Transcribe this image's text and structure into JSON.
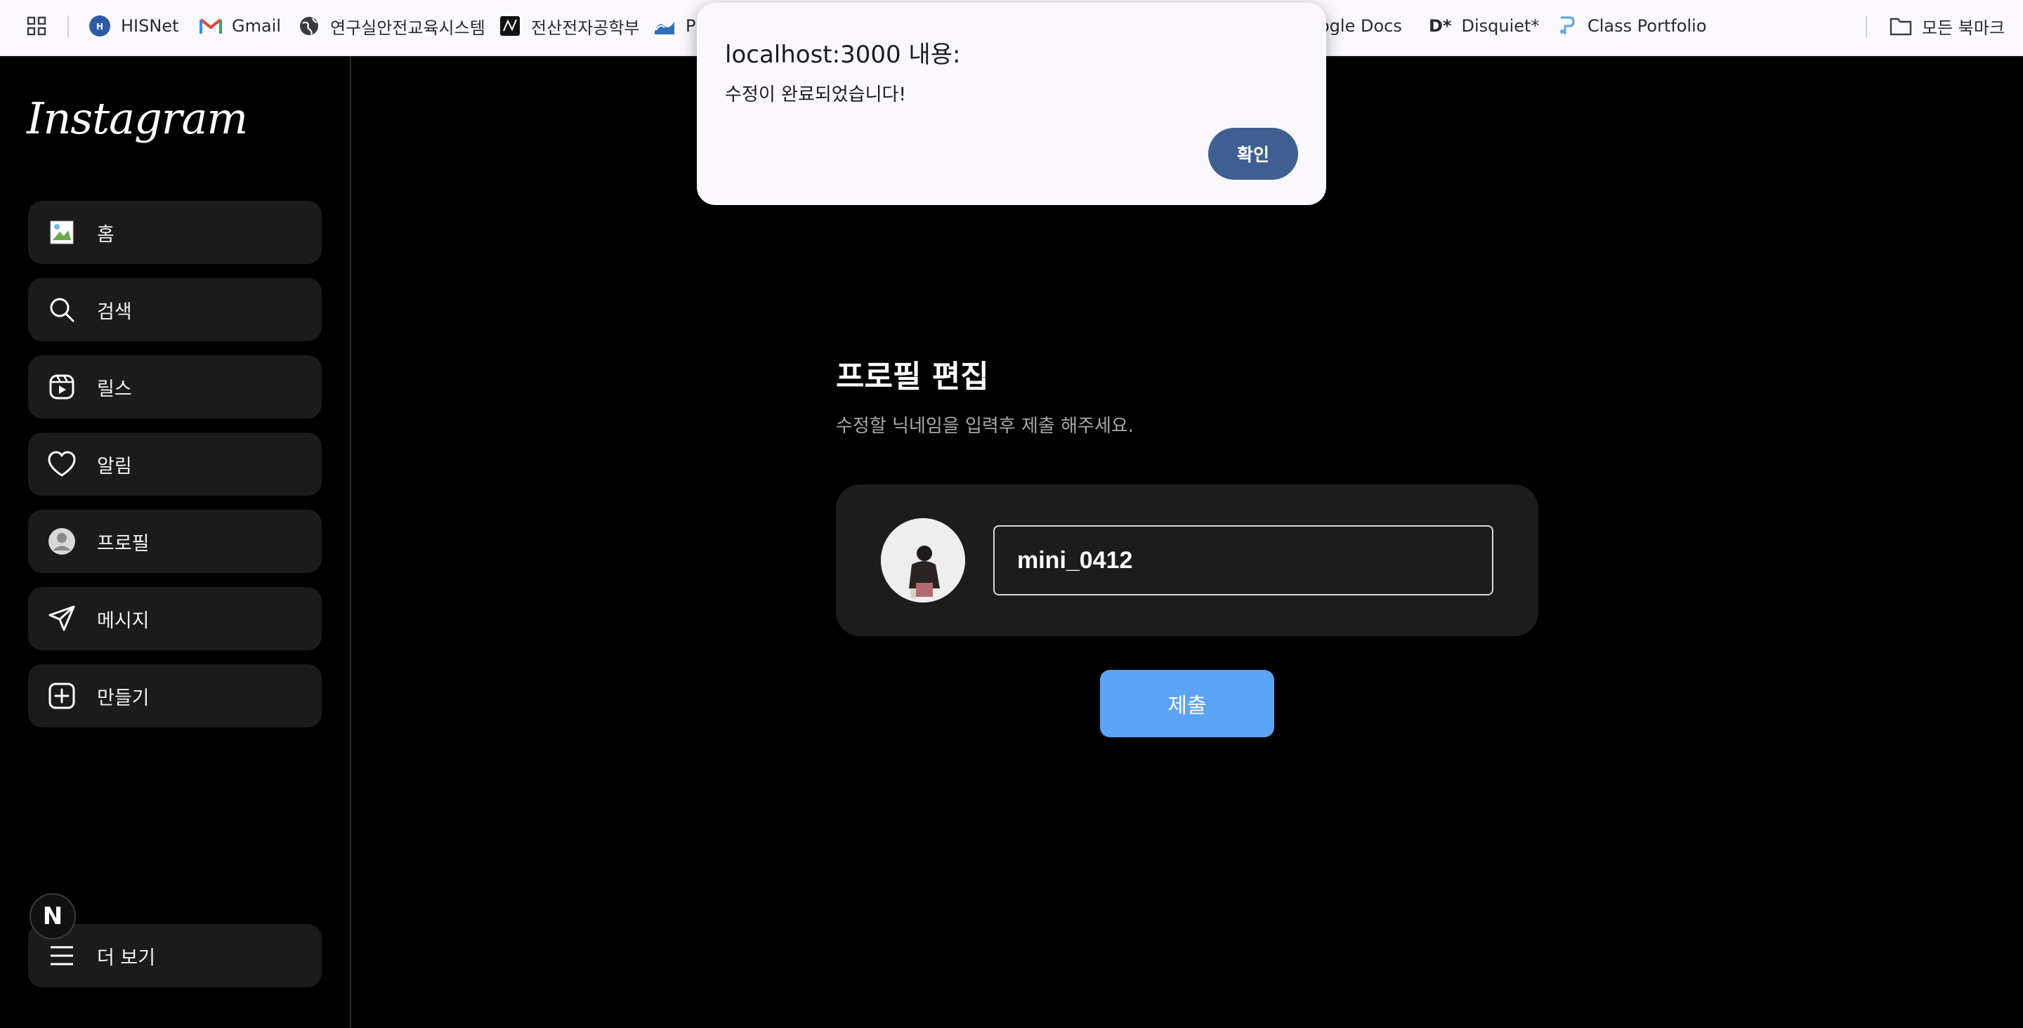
{
  "bookmarks": {
    "apps_icon": "apps-grid-icon",
    "items": [
      {
        "label": "HISNet",
        "icon": "hisnet-icon"
      },
      {
        "label": "Gmail",
        "icon": "gmail-icon"
      },
      {
        "label": "연구실안전교육시스템",
        "icon": "globe-icon"
      },
      {
        "label": "전산전자공학부",
        "icon": "dept-icon"
      },
      {
        "label": "P",
        "icon": "wave-icon"
      },
      {
        "label": "ogle Docs",
        "icon": ""
      },
      {
        "label": "Disquiet*",
        "icon": "disquiet-icon",
        "badge": "D*"
      },
      {
        "label": "Class Portfolio",
        "icon": "portfolio-icon"
      }
    ],
    "all_bookmarks": "모든 북마크"
  },
  "sidebar": {
    "logo": "Instagram",
    "items": [
      {
        "label": "홈",
        "icon": "home-image-icon"
      },
      {
        "label": "검색",
        "icon": "search-icon"
      },
      {
        "label": "릴스",
        "icon": "reels-icon"
      },
      {
        "label": "알림",
        "icon": "heart-icon"
      },
      {
        "label": "프로필",
        "icon": "profile-avatar-icon"
      },
      {
        "label": "메시지",
        "icon": "send-icon"
      },
      {
        "label": "만들기",
        "icon": "plus-square-icon"
      }
    ],
    "more": {
      "label": "더 보기",
      "icon": "menu-icon"
    },
    "next_badge": "N"
  },
  "main": {
    "title": "프로필 편집",
    "subtitle": "수정할 닉네임을 입력후 제출 해주세요.",
    "nickname_value": "mini_0412",
    "submit_label": "제출"
  },
  "dialog": {
    "title": "localhost:3000 내용:",
    "message": "수정이 완료되었습니다!",
    "ok_label": "확인"
  },
  "colors": {
    "accent": "#5ba4f5",
    "dialog_button": "#3f5f92",
    "nav_bg": "#1b1b1b",
    "card_bg": "#1c1c1c"
  }
}
